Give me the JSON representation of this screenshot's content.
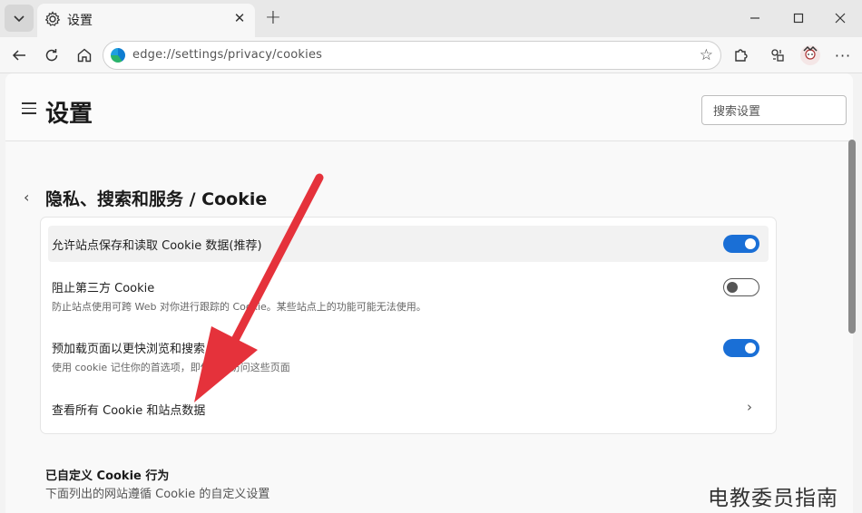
{
  "window": {
    "tab_title": "设置",
    "tab_icon": "gear-icon"
  },
  "toolbar": {
    "url": "edge://settings/privacy/cookies"
  },
  "header": {
    "title": "设置",
    "search_placeholder": "搜索设置"
  },
  "breadcrumb": "隐私、搜索和服务 / Cookie",
  "cookie_settings": {
    "items": [
      {
        "label": "允许站点保存和读取 Cookie 数据(推荐)",
        "toggle": "on"
      },
      {
        "label": "阻止第三方 Cookie",
        "description": "防止站点使用可跨 Web 对你进行跟踪的 Cookie。某些站点上的功能可能无法使用。",
        "toggle": "off"
      },
      {
        "label": "预加载页面以更快浏览和搜索",
        "description": "使用 cookie 记住你的首选项，即使你不访问这些页面",
        "toggle": "on"
      },
      {
        "label": "查看所有 Cookie 和站点数据"
      }
    ]
  },
  "custom_section": {
    "title": "已自定义 Cookie 行为",
    "description": "下面列出的网站遵循 Cookie 的自定义设置"
  },
  "watermark": "电教委员指南",
  "colors": {
    "accent": "#1a6fd6",
    "arrow": "#e5323b"
  }
}
